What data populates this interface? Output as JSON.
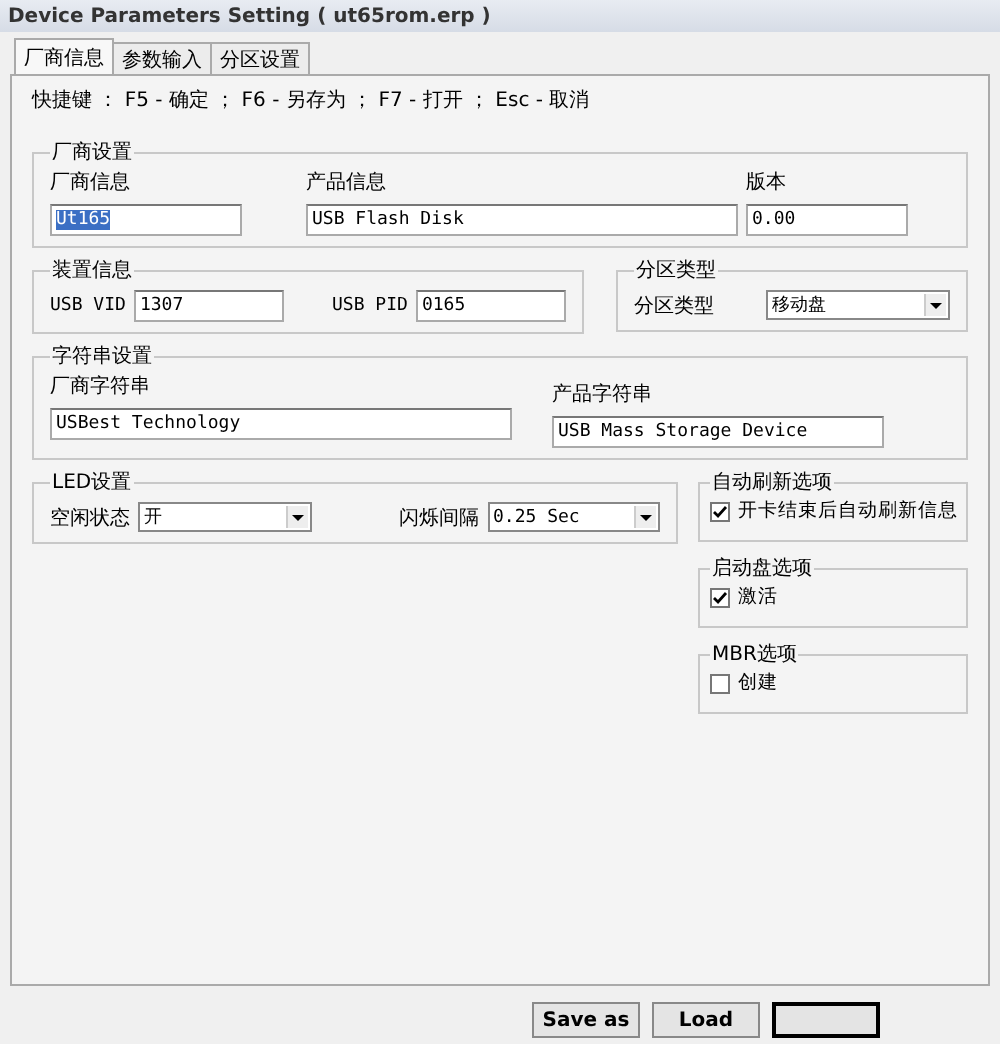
{
  "window": {
    "title": "Device Parameters Setting ( ut65rom.erp )"
  },
  "tabs": [
    {
      "label": "厂商信息",
      "selected": true
    },
    {
      "label": "参数输入",
      "selected": false
    },
    {
      "label": "分区设置",
      "selected": false
    }
  ],
  "shortcut_hint": "快捷键 ： F5 - 确定 ； F6 - 另存为 ； F7 - 打开 ； Esc - 取消",
  "vendor_settings": {
    "title": "厂商设置",
    "fields": [
      {
        "label": "厂商信息",
        "value": "Ut165",
        "text_selected": true
      },
      {
        "label": "产品信息",
        "value": "USB Flash Disk",
        "text_selected": false
      },
      {
        "label": "版本",
        "value": "0.00",
        "text_selected": false
      }
    ]
  },
  "device_info": {
    "title": "装置信息",
    "fields": [
      {
        "label": "USB VID",
        "value": "1307"
      },
      {
        "label": "USB PID",
        "value": "0165"
      }
    ]
  },
  "partition_type": {
    "title": "分区类型",
    "label": "分区类型",
    "value": "移动盘"
  },
  "strings": {
    "title": "字符串设置",
    "fields": [
      {
        "label": "厂商字符串",
        "value": "USBest Technology"
      },
      {
        "label": "产品字符串",
        "value": "USB Mass Storage Device"
      }
    ]
  },
  "led": {
    "title": "LED设置",
    "fields": [
      {
        "label": "空闲状态",
        "value": "开"
      },
      {
        "label": "闪烁间隔",
        "value": "0.25 Sec"
      }
    ]
  },
  "options": [
    {
      "title": "自动刷新选项",
      "label": "开卡结束后自动刷新信息",
      "checked": true
    },
    {
      "title": "启动盘选项",
      "label": "激活",
      "checked": true
    },
    {
      "title": "MBR选项",
      "label": "创建",
      "checked": false
    }
  ],
  "buttons": [
    {
      "label": "Save as",
      "focused": false
    },
    {
      "label": "Load",
      "focused": false
    },
    {
      "focused": true
    }
  ]
}
